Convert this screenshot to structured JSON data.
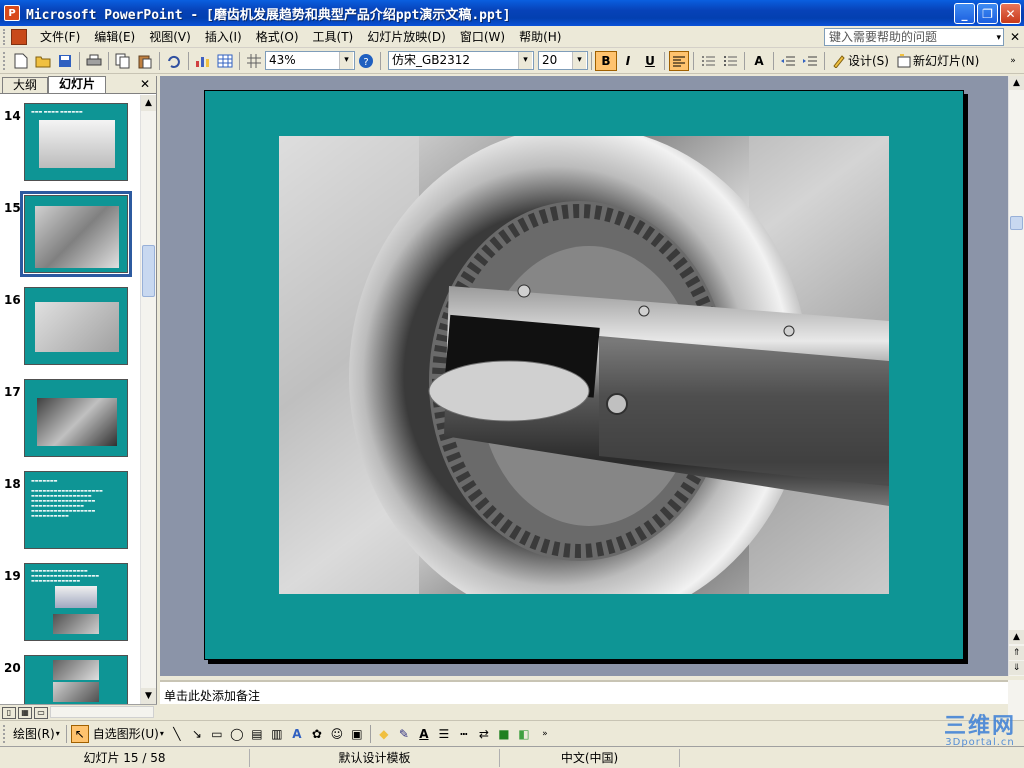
{
  "window": {
    "title": "Microsoft PowerPoint - [磨齿机发展趋势和典型产品介绍ppt演示文稿.ppt]",
    "app_icon_glyph": "P",
    "minimize_glyph": "_",
    "maximize_glyph": "❐",
    "close_glyph": "✕"
  },
  "menu": {
    "items": [
      "文件(F)",
      "编辑(E)",
      "视图(V)",
      "插入(I)",
      "格式(O)",
      "工具(T)",
      "幻灯片放映(D)",
      "窗口(W)",
      "帮助(H)"
    ],
    "help_placeholder": "键入需要帮助的问题",
    "help_arrow": "▾",
    "close_glyph": "✕"
  },
  "toolbar": {
    "zoom": "43%",
    "font_name": "仿宋_GB2312",
    "font_size": "20",
    "bold_label": "B",
    "italic_label": "I",
    "underline_label": "U",
    "design_label": "设计(S)",
    "new_slide_label": "新幻灯片(N)",
    "dropdown_arrow": "▾",
    "font_grow_label": "A"
  },
  "outline_pane": {
    "tabs": [
      "大纲",
      "幻灯片"
    ],
    "active_tab": "幻灯片",
    "close_glyph": "✕",
    "slides": [
      {
        "number": "14"
      },
      {
        "number": "15",
        "selected": true
      },
      {
        "number": "16"
      },
      {
        "number": "17"
      },
      {
        "number": "18"
      },
      {
        "number": "19"
      },
      {
        "number": "20"
      }
    ]
  },
  "notes": {
    "placeholder": "单击此处添加备注"
  },
  "drawing_toolbar": {
    "draw_label": "绘图(R)",
    "autoshapes_label": "自选图形(U)",
    "font_color_label": "A"
  },
  "status": {
    "slide_info": "幻灯片 15 / 58",
    "template": "默认设计模板",
    "language": "中文(中国)"
  },
  "watermark": {
    "main": "三维网",
    "sub": "3Dportal.cn"
  },
  "colors": {
    "slide_background": "#0e9595",
    "titlebar": "#0742b8",
    "workspace": "#8b94a8"
  }
}
